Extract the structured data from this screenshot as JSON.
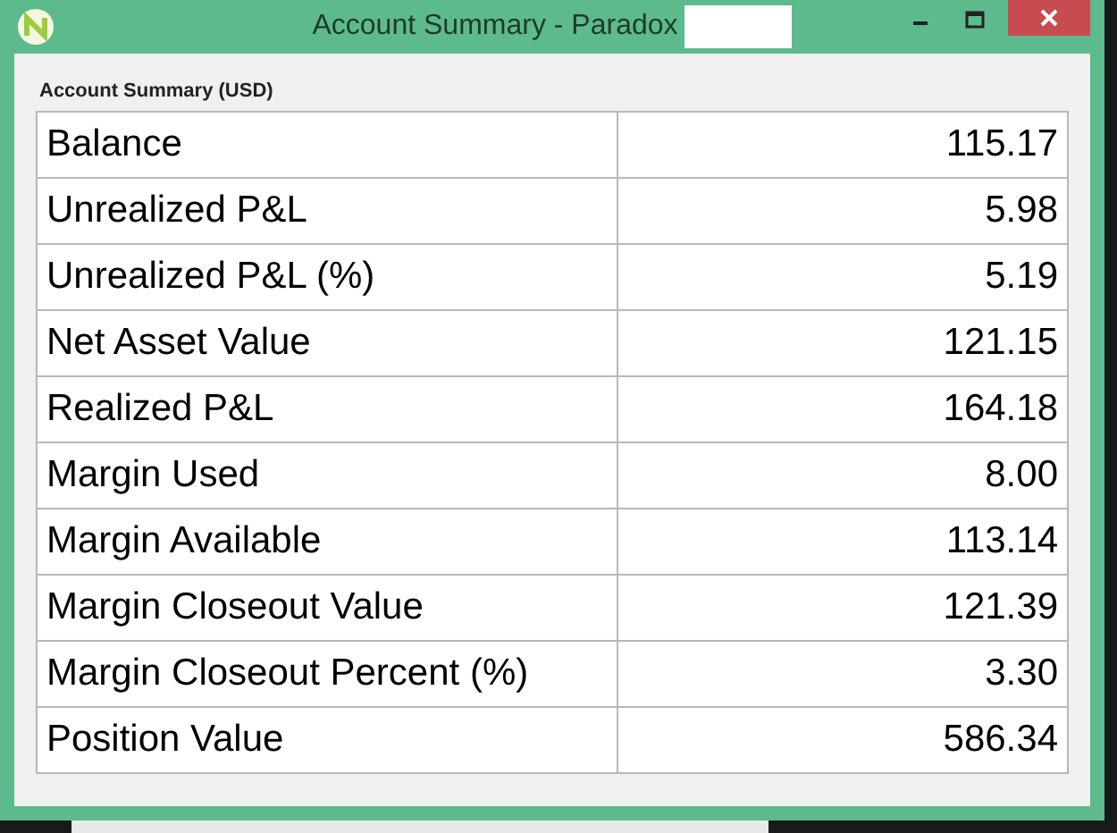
{
  "window": {
    "title": "Account Summary - Paradox"
  },
  "panel": {
    "heading": "Account Summary (USD)"
  },
  "rows": [
    {
      "label": "Balance",
      "value": "115.17"
    },
    {
      "label": "Unrealized P&L",
      "value": "5.98"
    },
    {
      "label": "Unrealized P&L (%)",
      "value": "5.19"
    },
    {
      "label": "Net Asset Value",
      "value": "121.15"
    },
    {
      "label": "Realized P&L",
      "value": "164.18"
    },
    {
      "label": "Margin Used",
      "value": "8.00"
    },
    {
      "label": "Margin Available",
      "value": "113.14"
    },
    {
      "label": "Margin Closeout Value",
      "value": "121.39"
    },
    {
      "label": "Margin Closeout Percent (%)",
      "value": "3.30"
    },
    {
      "label": "Position Value",
      "value": "586.34"
    }
  ]
}
